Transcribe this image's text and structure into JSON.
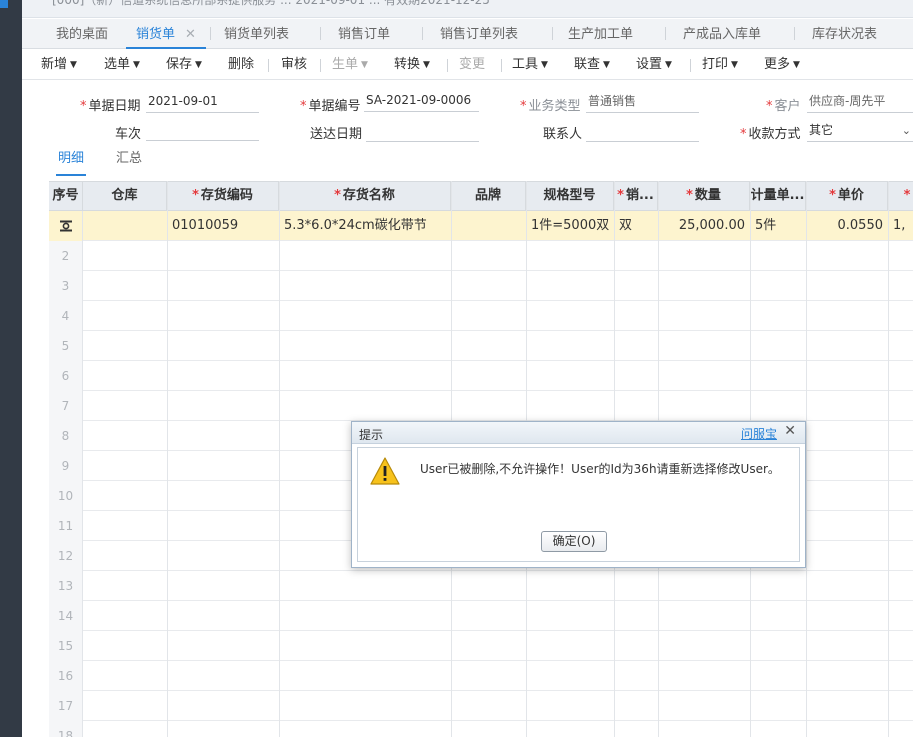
{
  "window": {
    "title_fragment": "[000]（新）信道系统信息所部系提供服务 ... 2021-09-01 ... 有效期2021-12-25"
  },
  "tabs": [
    {
      "label": "我的桌面",
      "active": false,
      "closable": false
    },
    {
      "label": "销货单",
      "active": true,
      "closable": true,
      "close_glyph": "✕"
    },
    {
      "label": "销货单列表",
      "active": false,
      "closable": false
    },
    {
      "label": "销售订单",
      "active": false,
      "closable": false
    },
    {
      "label": "销售订单列表",
      "active": false,
      "closable": false
    },
    {
      "label": "生产加工单",
      "active": false,
      "closable": false
    },
    {
      "label": "产成品入库单",
      "active": false,
      "closable": false
    },
    {
      "label": "库存状况表",
      "active": false,
      "closable": false
    }
  ],
  "toolbar": {
    "items": [
      {
        "label": "新增",
        "dropdown": true,
        "disabled": false
      },
      {
        "label": "选单",
        "dropdown": true,
        "disabled": false
      },
      {
        "label": "保存",
        "dropdown": true,
        "disabled": false
      },
      {
        "label": "删除",
        "dropdown": false,
        "disabled": false
      },
      {
        "label": "审核",
        "dropdown": false,
        "disabled": false
      },
      {
        "label": "生单",
        "dropdown": true,
        "disabled": true
      },
      {
        "label": "转换",
        "dropdown": true,
        "disabled": false
      },
      {
        "label": "变更",
        "dropdown": false,
        "disabled": true
      },
      {
        "label": "工具",
        "dropdown": true,
        "disabled": false
      },
      {
        "label": "联查",
        "dropdown": true,
        "disabled": false
      },
      {
        "label": "设置",
        "dropdown": true,
        "disabled": false
      },
      {
        "label": "打印",
        "dropdown": true,
        "disabled": false
      },
      {
        "label": "更多",
        "dropdown": true,
        "disabled": false
      }
    ]
  },
  "form": {
    "doc_date": {
      "label": "单据日期",
      "value": "2021-09-01",
      "required": true
    },
    "doc_no": {
      "label": "单据编号",
      "value": "SA-2021-09-0006",
      "required": true
    },
    "biz_type": {
      "label": "业务类型",
      "value": "普通销售",
      "required": true
    },
    "customer": {
      "label": "客户",
      "value": "供应商-周先平",
      "required": true
    },
    "vehicle": {
      "label": "车次",
      "value": ""
    },
    "delivery_date": {
      "label": "送达日期",
      "value": ""
    },
    "contact": {
      "label": "联系人",
      "value": ""
    },
    "payment": {
      "label": "收款方式",
      "value": "其它",
      "required": true
    }
  },
  "subtabs": [
    {
      "label": "明细",
      "active": true
    },
    {
      "label": "汇总",
      "active": false
    }
  ],
  "grid": {
    "columns": [
      {
        "key": "seq",
        "label": "序号",
        "required": false
      },
      {
        "key": "warehouse",
        "label": "仓库",
        "required": false
      },
      {
        "key": "code",
        "label": "存货编码",
        "required": true
      },
      {
        "key": "name",
        "label": "存货名称",
        "required": true
      },
      {
        "key": "brand",
        "label": "品牌",
        "required": false
      },
      {
        "key": "spec",
        "label": "规格型号",
        "required": false
      },
      {
        "key": "sale_unit",
        "label": "销...",
        "required": true
      },
      {
        "key": "qty",
        "label": "数量",
        "required": true
      },
      {
        "key": "unit",
        "label": "计量单...",
        "required": false
      },
      {
        "key": "price",
        "label": "单价",
        "required": true
      },
      {
        "key": "amount",
        "label": "",
        "required": true
      }
    ],
    "rows": [
      {
        "seq": "",
        "warehouse": "",
        "code": "01010059",
        "name": "5.3*6.0*24cm碳化带节",
        "brand": "",
        "spec": "1件=5000双",
        "sale_unit": "双",
        "qty": "25,000.00",
        "unit": "5件",
        "price": "0.0550",
        "amount": "1,"
      },
      {
        "seq": "2"
      },
      {
        "seq": "3"
      },
      {
        "seq": "4"
      },
      {
        "seq": "5"
      },
      {
        "seq": "6"
      },
      {
        "seq": "7"
      },
      {
        "seq": "8"
      },
      {
        "seq": "9"
      },
      {
        "seq": "10"
      },
      {
        "seq": "11"
      },
      {
        "seq": "12"
      },
      {
        "seq": "13"
      },
      {
        "seq": "14"
      },
      {
        "seq": "15"
      },
      {
        "seq": "16"
      },
      {
        "seq": "17"
      },
      {
        "seq": "18"
      }
    ]
  },
  "dialog": {
    "title": "提示",
    "help_link": "问服宝",
    "close_glyph": "✕",
    "message": "User已被删除,不允许操作！User的Id为36h请重新选择修改User。",
    "ok_label": "确定(O)",
    "icon": "warning-icon"
  },
  "colors": {
    "accent": "#2a83d8",
    "required": "#e4393c",
    "selected_row": "#fdf4cf",
    "sidebar": "#323a45"
  }
}
